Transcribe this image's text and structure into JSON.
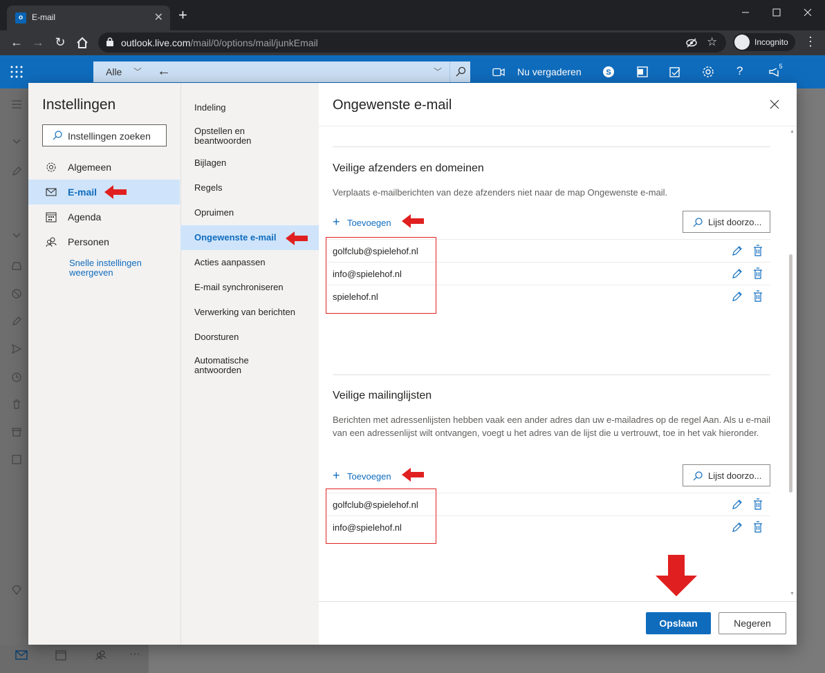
{
  "browser": {
    "tab_title": "E-mail",
    "url_host": "outlook.live.com",
    "url_path": "/mail/0/options/mail/junkEmail",
    "incognito_label": "Incognito"
  },
  "header": {
    "search_scope": "Alle",
    "meet_label": "Nu vergaderen",
    "notification_count": "5"
  },
  "settings": {
    "title": "Instellingen",
    "search_placeholder": "Instellingen zoeken",
    "categories": [
      {
        "label": "Algemeen",
        "icon": "gear-icon"
      },
      {
        "label": "E-mail",
        "icon": "mail-icon"
      },
      {
        "label": "Agenda",
        "icon": "calendar-icon"
      },
      {
        "label": "Personen",
        "icon": "people-icon"
      }
    ],
    "quick_settings": "Snelle instellingen weergeven",
    "subnav": [
      "Indeling",
      "Opstellen en beantwoorden",
      "Bijlagen",
      "Regels",
      "Opruimen",
      "Ongewenste e-mail",
      "Acties aanpassen",
      "E-mail synchroniseren",
      "Verwerking van berichten",
      "Doorsturen",
      "Automatische antwoorden"
    ]
  },
  "content": {
    "title": "Ongewenste e-mail",
    "safe_senders": {
      "title": "Veilige afzenders en domeinen",
      "description": "Verplaats e-mailberichten van deze afzenders niet naar de map Ongewenste e-mail.",
      "add_label": "Toevoegen",
      "search_label": "Lijst doorzo...",
      "items": [
        "golfclub@spielehof.nl",
        "info@spielehof.nl",
        "spielehof.nl"
      ]
    },
    "safe_lists": {
      "title": "Veilige mailinglijsten",
      "description": "Berichten met adressenlijsten hebben vaak een ander adres dan uw e-mailadres op de regel Aan. Als u e-mail van een adressenlijst wilt ontvangen, voegt u het adres van de lijst die u vertrouwt, toe in het vak hieronder.",
      "add_label": "Toevoegen",
      "search_label": "Lijst doorzo...",
      "items": [
        "golfclub@spielehof.nl",
        "info@spielehof.nl"
      ]
    },
    "save_label": "Opslaan",
    "cancel_label": "Negeren"
  },
  "colors": {
    "accent": "#0f6cbd",
    "selected_bg": "#cfe4fa",
    "annotation_red": "#e02020"
  }
}
